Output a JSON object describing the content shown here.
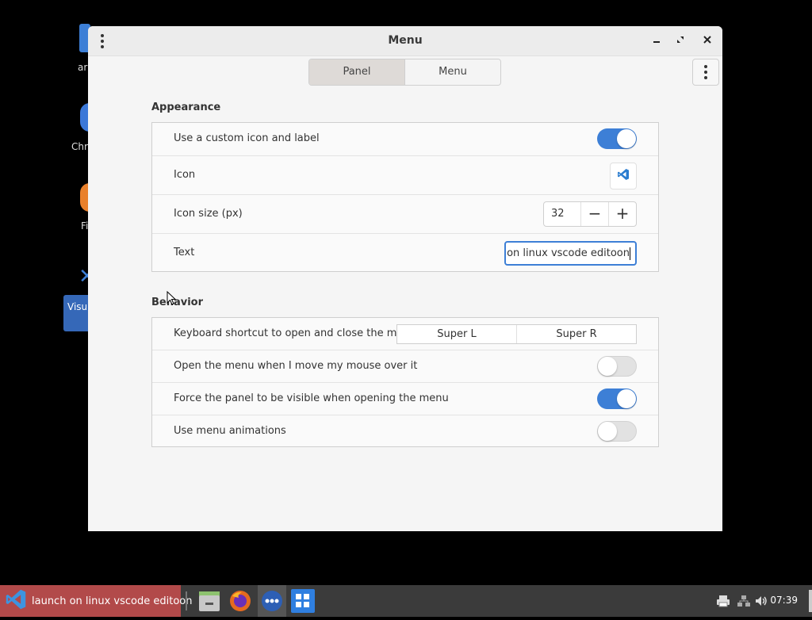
{
  "window": {
    "title": "Menu",
    "tabs": [
      {
        "label": "Panel",
        "active": true
      },
      {
        "label": "Menu",
        "active": false
      }
    ]
  },
  "appearance": {
    "title": "Appearance",
    "custom_icon_label": "Use a custom icon and label",
    "custom_icon_enabled": true,
    "icon_label": "Icon",
    "icon_name": "vscode-icon",
    "icon_size_label": "Icon size (px)",
    "icon_size_value": "32",
    "text_label": "Text",
    "text_value": "launch on linux vscode editoon"
  },
  "behavior": {
    "title": "Behavior",
    "shortcut_label": "Keyboard shortcut to open and close the menu",
    "shortcut_left": "Super L",
    "shortcut_right": "Super R",
    "open_on_hover_label": "Open the menu when I move my mouse over it",
    "open_on_hover": false,
    "force_visible_label": "Force the panel to be visible when opening the menu",
    "force_visible": true,
    "animations_label": "Use menu animations",
    "animations": false
  },
  "desktop": {
    "icons": [
      "ar",
      "Chr",
      "Fi",
      "Visu"
    ]
  },
  "taskbar": {
    "active_task_label": "launch on linux vscode editoon",
    "time": "07:39"
  },
  "colors": {
    "accent": "#3d7fd6",
    "taskbar_active": "#b24a4a",
    "taskbar": "#3b3b3b"
  }
}
